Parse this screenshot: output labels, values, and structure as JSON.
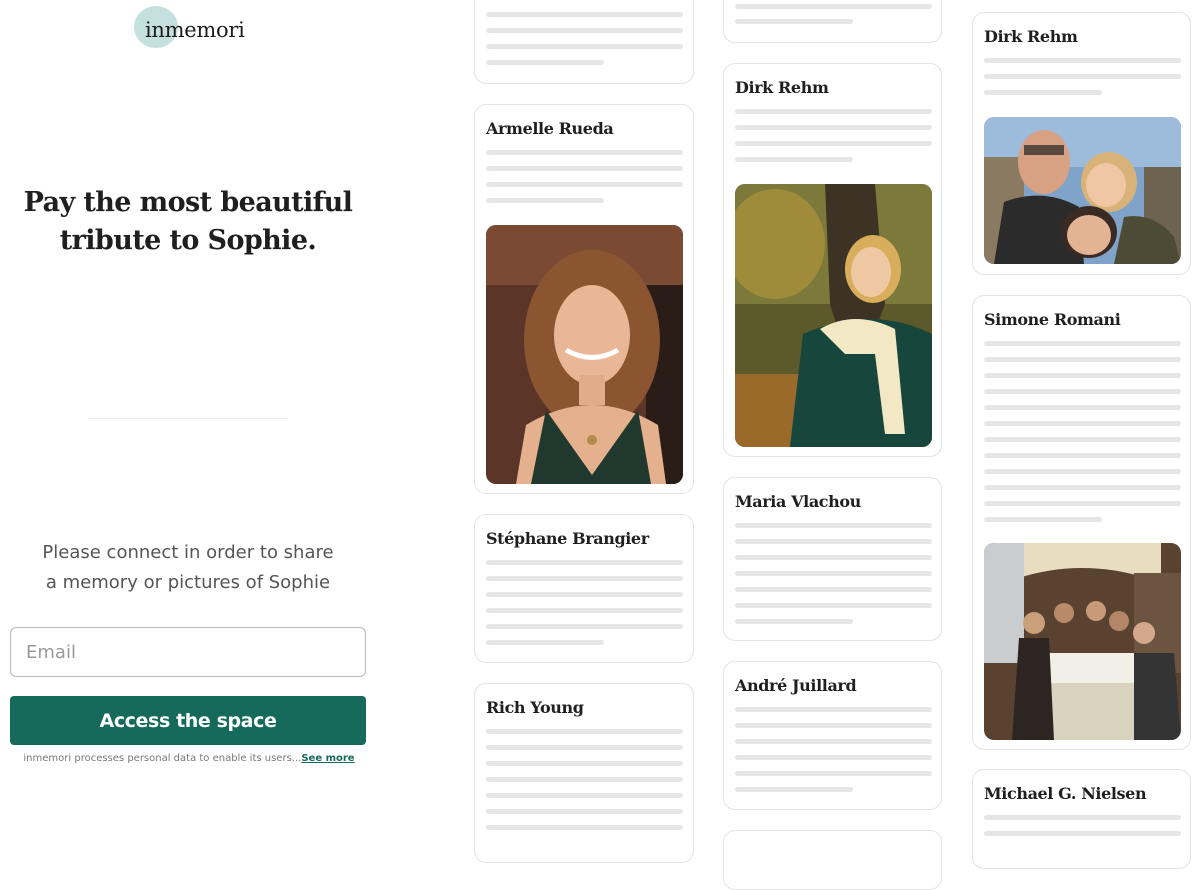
{
  "brand": {
    "logo_text": "inmemori",
    "accent": "#156a5c",
    "blob": "#c4e0df"
  },
  "login": {
    "headline_line1": "Pay the most beautiful",
    "headline_line2": "tribute to Sophie.",
    "connect_line1": "Please connect in order to share",
    "connect_line2": "a memory or pictures of Sophie",
    "email_placeholder": "Email",
    "email_value": "",
    "submit_label": "Access the space",
    "privacy_text": "inmemori processes personal data to enable its users...",
    "privacy_link": "See more"
  },
  "feed": {
    "col1": [
      {
        "name": ""
      },
      {
        "name": "Armelle Rueda",
        "photo": "woman-smiling-portrait"
      },
      {
        "name": "Stéphane Brangier"
      },
      {
        "name": "Rich Young"
      }
    ],
    "col2": [
      {
        "name": ""
      },
      {
        "name": "Dirk Rehm",
        "photo": "woman-autumn-tree"
      },
      {
        "name": "Maria Vlachou"
      },
      {
        "name": "André Juillard"
      }
    ],
    "col3": [
      {
        "name": "Dirk Rehm",
        "photo": "selfie-group-paris"
      },
      {
        "name": "Simone Romani",
        "photo": "dinner-group-restaurant"
      },
      {
        "name": "Michael G. Nielsen"
      }
    ]
  }
}
